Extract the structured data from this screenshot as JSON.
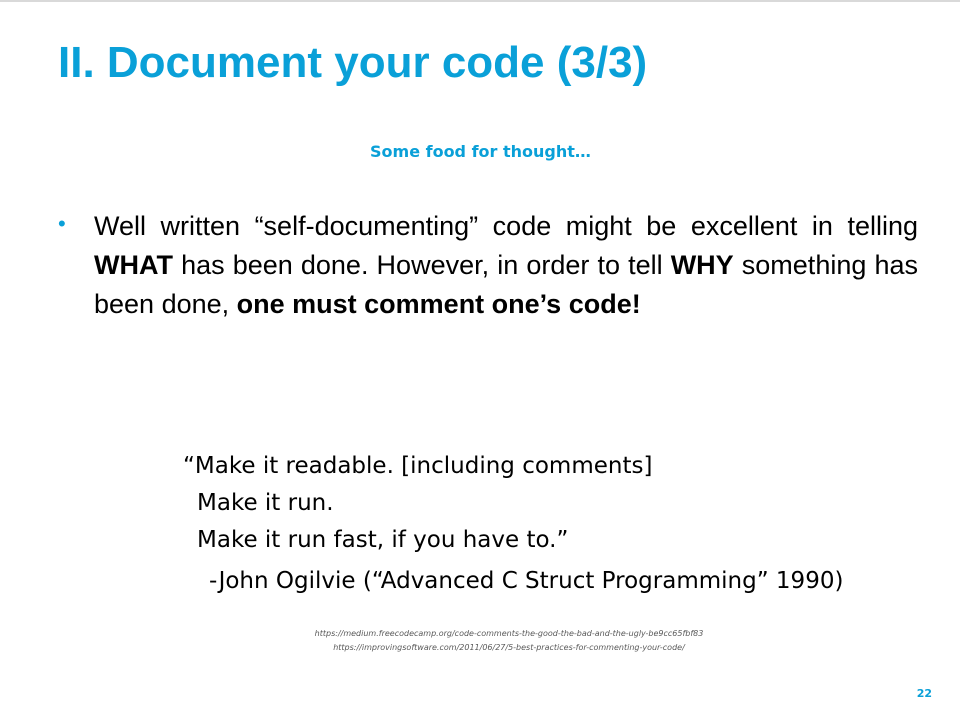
{
  "slide": {
    "title": "II. Document your code (3/3)",
    "subtitle": "Some food for thought…",
    "bullet": {
      "marker": "•",
      "parts": [
        "Well written “self-documenting” code might be excellent in telling ",
        "WHAT",
        " has been done. However, in order to tell ",
        "WHY",
        " something has been done, ",
        "one must comment one’s code!"
      ]
    },
    "quote": {
      "lines": [
        "“Make it readable. [including comments]",
        "Make it run.",
        "Make it run fast, if you have to.”"
      ],
      "attribution": "-John Ogilvie (“Advanced C Struct Programming” 1990)"
    },
    "references": [
      "https://medium.freecodecamp.org/code-comments-the-good-the-bad-and-the-ugly-be9cc65fbf83",
      "https://improvingsoftware.com/2011/06/27/5-best-practices-for-commenting-your-code/"
    ],
    "page_number": "22",
    "colors": {
      "accent": "#0aa0d8",
      "text": "#000000",
      "muted": "#595959"
    }
  }
}
